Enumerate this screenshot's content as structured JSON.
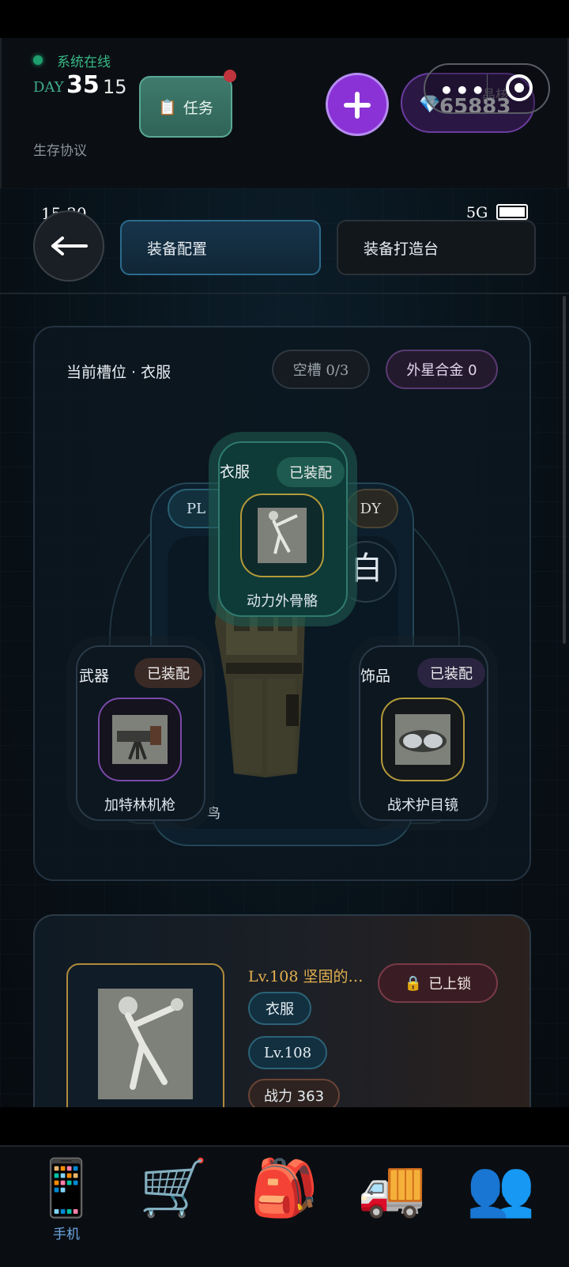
{
  "header": {
    "status_text": "系统在线",
    "day_label": "DAY",
    "day_number": "35",
    "day_sub": "15",
    "protocol": "生存协议",
    "task_label": "任务",
    "task_icon": "📋",
    "gem_icon": "💎",
    "gem_count": "65883",
    "gem_hint": "晶核",
    "capsule_dots": "•••"
  },
  "status_bar": {
    "time": "15:30",
    "network": "5G"
  },
  "tabs": [
    {
      "label": "装备配置"
    },
    {
      "label": "装备打造台"
    }
  ],
  "equip_card": {
    "slot_title": "当前槽位 · 衣服",
    "empty_slots": "空槽 0/3",
    "alloy": "外星合金 0",
    "pl_label": "PL",
    "dy_label": "DY",
    "bai_char": "白",
    "niao_char": "鸟"
  },
  "slots": {
    "clothes": {
      "label": "衣服",
      "badge": "已装配",
      "item": "动力外骨骼"
    },
    "weapon": {
      "label": "武器",
      "badge": "已装配",
      "item": "加特林机枪"
    },
    "accessory": {
      "label": "饰品",
      "badge": "已装配",
      "item": "战术护目镜"
    }
  },
  "detail": {
    "title": "Lv.108 坚固的…",
    "lock_icon": "🔒",
    "lock_label": "已上锁",
    "tags": [
      "衣服",
      "Lv.108",
      "战力 363"
    ]
  },
  "nav": [
    {
      "icon": "📱",
      "label": "手机"
    },
    {
      "icon": "🛒",
      "label": ""
    },
    {
      "icon": "🎒",
      "label": ""
    },
    {
      "icon": "🚚",
      "label": ""
    },
    {
      "icon": "👥",
      "label": ""
    }
  ],
  "colors": {
    "accent_green": "#38b985",
    "accent_purple": "#8a32d6",
    "gold": "#e3b04f",
    "nav_label": "#6ea6e0"
  }
}
